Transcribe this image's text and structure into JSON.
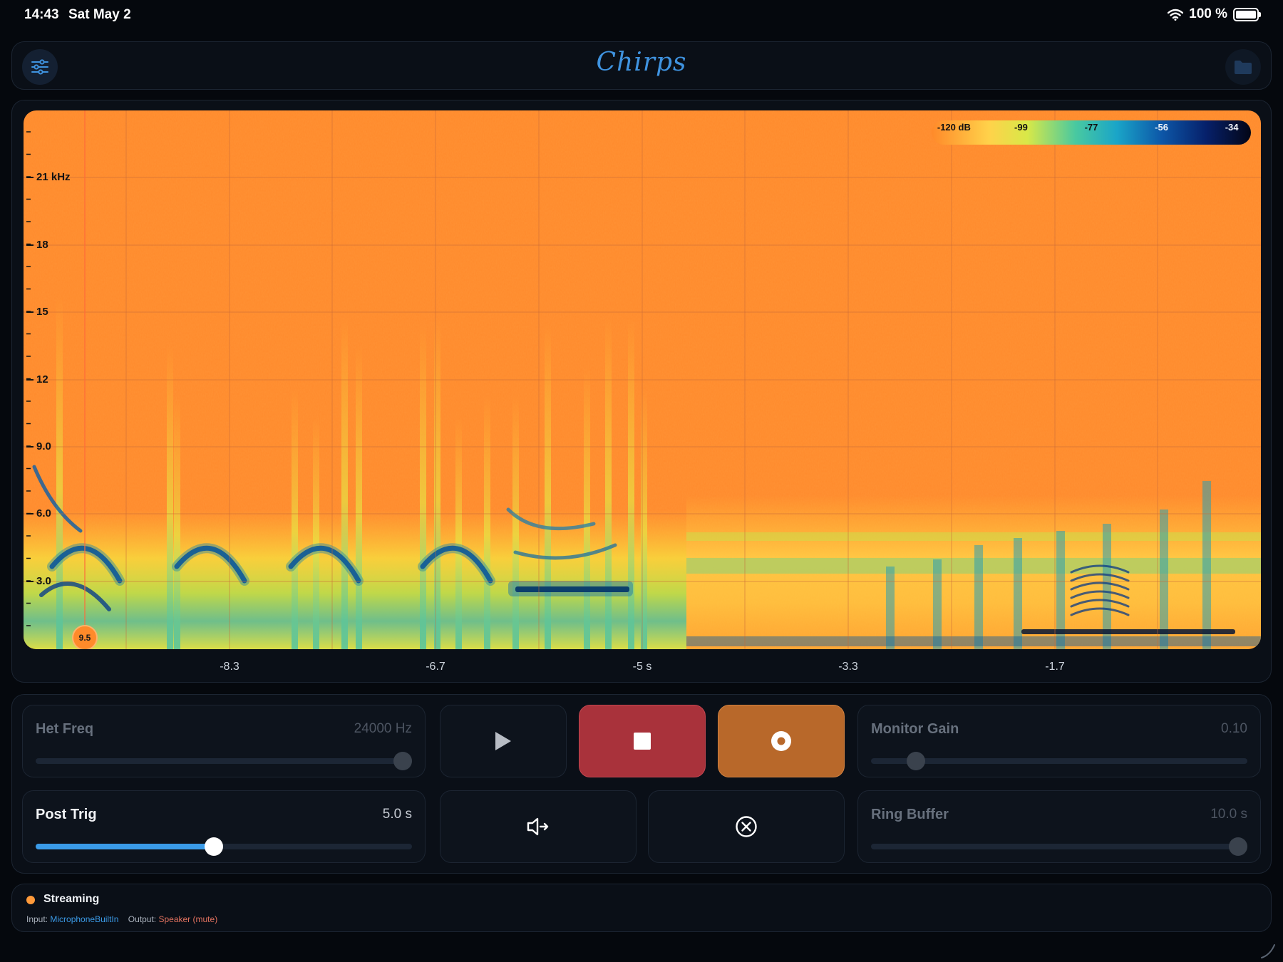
{
  "status_bar": {
    "time": "14:43",
    "date": "Sat May 2",
    "battery": "100 %"
  },
  "header": {
    "title": "Chirps"
  },
  "spectrogram": {
    "y_ticks": [
      "21 kHz",
      "18",
      "15",
      "12",
      "9.0",
      "6.0",
      "3.0"
    ],
    "x_ticks": [
      "-8.3",
      "-6.7",
      "-5 s",
      "-3.3",
      "-1.7"
    ],
    "colorbar_labels": [
      "-120 dB",
      "-99",
      "-77",
      "-56",
      "-34"
    ],
    "cursor_value": "9.5"
  },
  "controls": {
    "het_freq": {
      "label": "Het Freq",
      "value": "24000 Hz",
      "level": 0.975
    },
    "monitor_gain": {
      "label": "Monitor Gain",
      "value": "0.10",
      "level": 0.12
    },
    "post_trig": {
      "label": "Post Trig",
      "value": "5.0 s",
      "level": 0.474
    },
    "ring_buffer": {
      "label": "Ring Buffer",
      "value": "10.0 s",
      "level": 0.975
    }
  },
  "footer": {
    "status": "Streaming",
    "input_label": "Input:",
    "input_value": "MicrophoneBuiltIn",
    "output_label": "Output:",
    "output_value": "Speaker (mute)"
  }
}
